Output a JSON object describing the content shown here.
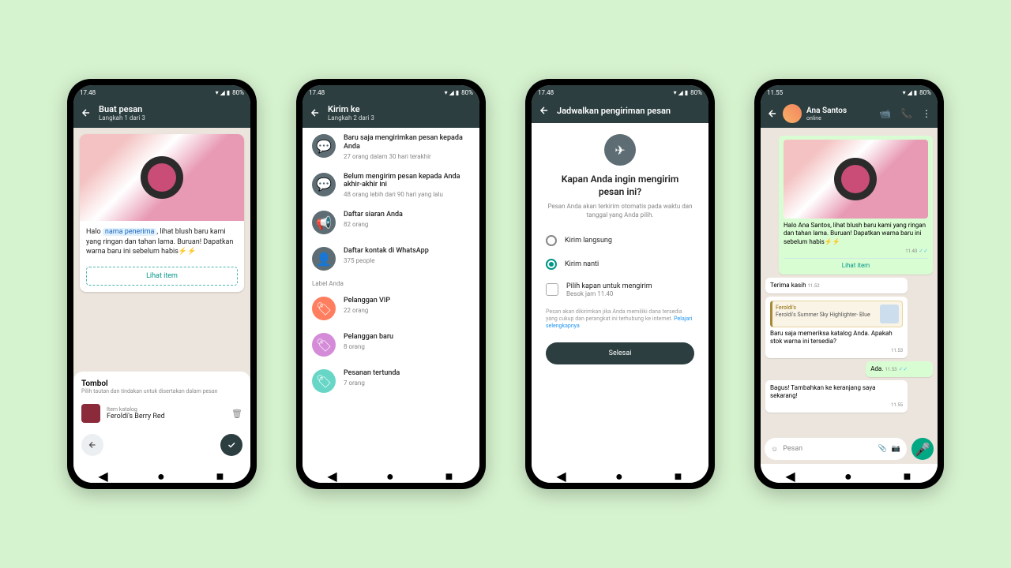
{
  "status": {
    "time1": "17.48",
    "time4": "11.55",
    "battery": "80%"
  },
  "phone1": {
    "title": "Buat pesan",
    "subtitle": "Langkah 1 dari 3",
    "message_pre": "Halo ",
    "placeholder": "nama penerima",
    "message_post": ", lihat blush baru kami yang ringan dan tahan lama. Buruan! Dapatkan warna baru ini sebelum habis⚡⚡",
    "view_item": "Lihat item",
    "panel_title": "Tombol",
    "panel_sub": "Pilih tautan dan tindakan untuk disertakan dalam pesan",
    "catalog_label": "Item katalog",
    "catalog_name": "Feroldi's Berry Red"
  },
  "phone2": {
    "title": "Kirim ke",
    "subtitle": "Langkah 2 dari 3",
    "items": [
      {
        "title": "Baru saja mengirimkan pesan kepada Anda",
        "sub": "27 orang dalam 30 hari terakhir"
      },
      {
        "title": "Belum mengirim pesan kepada Anda akhir-akhir ini",
        "sub": "48 orang lebih dari 90 hari yang lalu"
      },
      {
        "title": "Daftar siaran Anda",
        "sub": "82 orang"
      },
      {
        "title": "Daftar kontak di WhatsApp",
        "sub": "375 people"
      }
    ],
    "section": "Label Anda",
    "labels": [
      {
        "title": "Pelanggan VIP",
        "sub": "22 orang",
        "color": "red"
      },
      {
        "title": "Pelanggan baru",
        "sub": "8 orang",
        "color": "pink"
      },
      {
        "title": "Pesanan tertunda",
        "sub": "7 orang",
        "color": "teal"
      }
    ]
  },
  "phone3": {
    "title": "Jadwalkan pengiriman pesan",
    "headline": "Kapan Anda ingin mengirim pesan ini?",
    "sub": "Pesan Anda akan terkirim otomatis pada waktu dan tanggal yang Anda pilih.",
    "opt1": "Kirim langsung",
    "opt2": "Kirim nanti",
    "schedule_title": "Pilih kapan untuk mengirim",
    "schedule_value": "Besok jam 11.40",
    "disclaimer": "Pesan akan dikirimkan jika Anda memiliki dana tersedia yang cukup dan perangkat ini terhubung ke internet.",
    "learn_more": "Pelajari selengkapnya",
    "done": "Selesai"
  },
  "phone4": {
    "name": "Ana Santos",
    "status": "online",
    "msg1": "Halo Ana Santos, lihat blush baru kami yang ringan dan tahan lama. Buruan! Dapatkan warna baru ini sebelum habis⚡⚡",
    "msg1_time": "11.40",
    "view_item": "Lihat item",
    "msg2": "Terima kasih",
    "msg2_time": "11.52",
    "product_brand": "Feroldi's",
    "product_name": "Feroldi's Summer Sky Highlighter- Blue",
    "msg3": "Baru saja memeriksa katalog Anda. Apakah stok warna ini tersedia?",
    "msg3_time": "11.53",
    "msg4": "Ada.",
    "msg4_time": "11.53",
    "msg5": "Bagus! Tambahkan ke keranjang saya sekarang!",
    "msg5_time": "11.55",
    "input_placeholder": "Pesan"
  }
}
